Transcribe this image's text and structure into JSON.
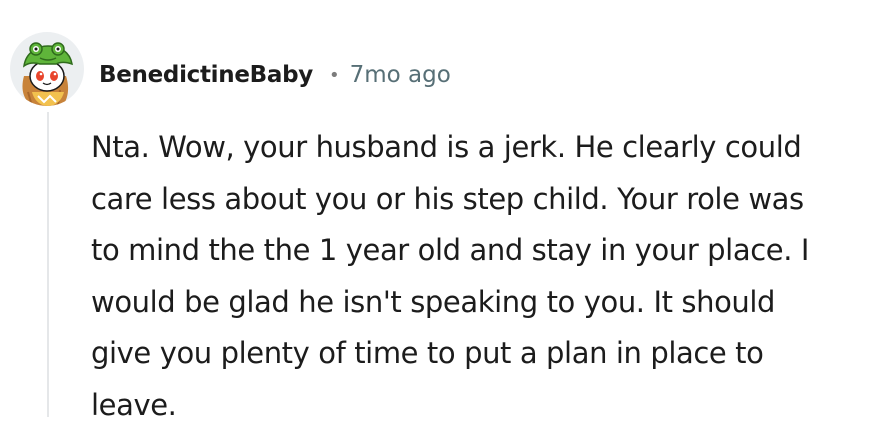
{
  "comment": {
    "author": "BenedictineBaby",
    "separator": "•",
    "timestamp": "7mo ago",
    "body": "Nta. Wow, your husband is a jerk. He clearly could\ncare less about you or his step child. Your role was\nto mind the the 1 year old and stay in your place. I\nwould be glad he isn't speaking to you. It should\ngive you plenty of time to put a plan in place to\nleave."
  },
  "colors": {
    "username": "#1c1c1c",
    "timestamp": "#576f76",
    "thread_line": "#e5e7e9",
    "avatar_hat": "#5fb53a",
    "avatar_hair": "#c8833a"
  },
  "icons": {
    "avatar": "snoo-avatar-green-frog-hat"
  }
}
